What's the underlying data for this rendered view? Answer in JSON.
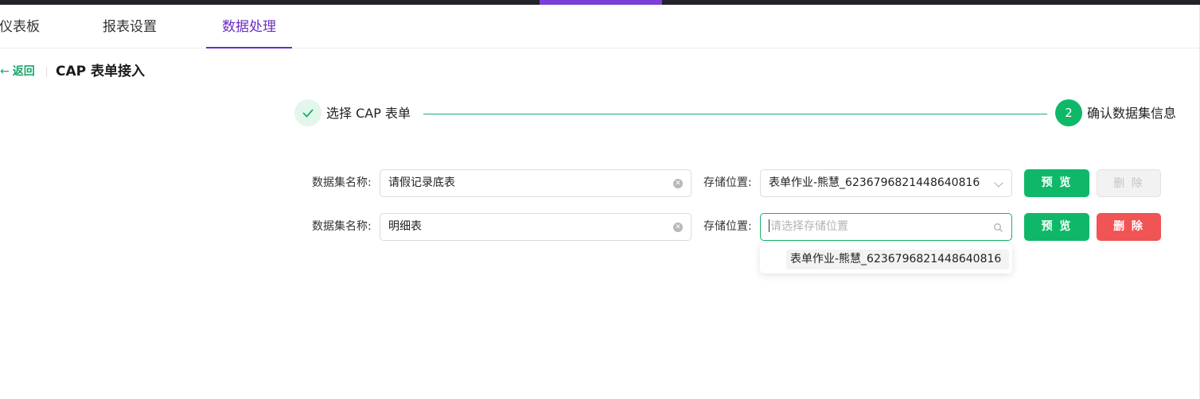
{
  "tabs": [
    {
      "label": "仪表板"
    },
    {
      "label": "报表设置"
    },
    {
      "label": "数据处理"
    }
  ],
  "active_tab": "数据处理",
  "breadcrumb": {
    "back_arrow": "←",
    "back_label": "返回",
    "page_title": "CAP 表单接入"
  },
  "steps": [
    {
      "icon": "check-icon",
      "label": "选择 CAP 表单",
      "status": "done"
    },
    {
      "number": "2",
      "label": "确认数据集信息",
      "status": "active"
    }
  ],
  "rows": [
    {
      "dataset_label": "数据集名称:",
      "dataset_name": "请假记录底表",
      "storage_label": "存储位置:",
      "storage_value": "表单作业-熊慧_6236796821448640816",
      "preview_label": "预 览",
      "delete_label": "删 除",
      "delete_enabled": false
    },
    {
      "dataset_label": "数据集名称:",
      "dataset_name": "明细表",
      "storage_label": "存储位置:",
      "storage_value": "",
      "storage_placeholder": "请选择存储位置",
      "preview_label": "预 览",
      "delete_label": "删 除",
      "delete_enabled": true
    }
  ],
  "dropdown": {
    "options": [
      "表单作业-熊慧_6236796821448640816"
    ]
  },
  "colors": {
    "brand_green": "#0fb868",
    "tab_active": "#6b2fc4",
    "delete_red": "#f05454",
    "top_bar": "#22222a"
  }
}
